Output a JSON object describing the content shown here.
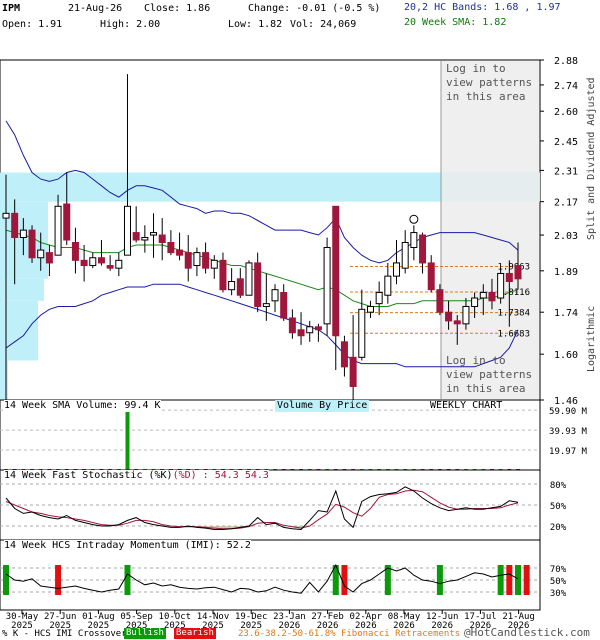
{
  "header": {
    "symbol": "IPM",
    "date": "21-Aug-26",
    "close": "Close: 1.86",
    "change": "Change: -0.01 (-0.5 %)",
    "open": "Open: 1.91",
    "high": "High: 2.00",
    "low": "Low: 1.82",
    "vol": "Vol: 24,069",
    "bands": "20,2 HC Bands: 1.68 , 1.97",
    "sma": "20 Week SMA: 1.82"
  },
  "side_label": "Split and Dividend Adjusted",
  "side_label2": "Logarithmic",
  "pattern_note_top": [
    "Log in to",
    "view patterns",
    "in this area"
  ],
  "pattern_note_bottom": [
    "Log in to",
    "view patterns",
    "in this area"
  ],
  "fib_levels": [
    "1.9063",
    "1.8116",
    "1.7384",
    "1.6683"
  ],
  "price_ticks": [
    "2.88",
    "2.74",
    "2.60",
    "2.45",
    "2.31",
    "2.17",
    "2.03",
    "1.89",
    "1.74",
    "1.60",
    "1.46"
  ],
  "vol_ticks": [
    "59.90 M",
    "39.93 M",
    "19.97 M"
  ],
  "stoch_ticks": [
    "80%",
    "50%",
    "20%"
  ],
  "imi_ticks": [
    "70%",
    "50%",
    "30%"
  ],
  "panel_labels": {
    "volume": "14 Week SMA Volume: 99.4 K",
    "vbp": "Volume By Price",
    "weekly": "WEEKLY CHART",
    "stoch_a": "14 Week Fast Stochastic (%K)",
    "stoch_b": "(%D) : 54.3",
    "stoch_c": "54.3",
    "imi": "14 Week HCS Intraday Momentum (IMI): 52.2"
  },
  "x_ticks": [
    "30-May 2025",
    "27-Jun 2025",
    "01-Aug 2025",
    "05-Sep 2025",
    "10-Oct 2025",
    "14-Nov 2025",
    "19-Dec 2025",
    "23-Jan 2026",
    "27-Feb 2026",
    "02-Apr 2026",
    "08-May 2026",
    "12-Jun 2026",
    "17-Jul 2026",
    "21-Aug 2026"
  ],
  "footer": {
    "crossover": "% K - HCS IMI Crossover:",
    "bullish": "Bullish",
    "bearish": "Bearish",
    "fib": "23.6-38.2-50-61.8% Fibonacci Retracements",
    "brand": "@HotCandlestick.com"
  },
  "colors": {
    "bull": "#ffffff",
    "bear": "#a0173c",
    "upper_band": "#1a1aa8",
    "sma": "#1a8a1a",
    "vbp": "#bff0fa",
    "fib": "#e07a10",
    "stoch_k": "#000000",
    "stoch_d": "#a0173c"
  },
  "chart_data": {
    "type": "candlestick",
    "scale": "log",
    "ylim": [
      1.46,
      2.88
    ],
    "candles": [
      {
        "o": 2.1,
        "h": 2.29,
        "l": 1.46,
        "c": 2.12
      },
      {
        "o": 2.12,
        "h": 2.18,
        "l": 1.84,
        "c": 2.02
      },
      {
        "o": 2.02,
        "h": 2.1,
        "l": 1.95,
        "c": 2.05
      },
      {
        "o": 2.05,
        "h": 2.07,
        "l": 1.92,
        "c": 1.94
      },
      {
        "o": 1.94,
        "h": 2.04,
        "l": 1.89,
        "c": 1.97
      },
      {
        "o": 1.96,
        "h": 1.99,
        "l": 1.87,
        "c": 1.92
      },
      {
        "o": 1.95,
        "h": 2.2,
        "l": 1.95,
        "c": 2.15
      },
      {
        "o": 2.16,
        "h": 2.3,
        "l": 1.99,
        "c": 2.01
      },
      {
        "o": 2.0,
        "h": 2.06,
        "l": 1.88,
        "c": 1.93
      },
      {
        "o": 1.93,
        "h": 1.99,
        "l": 1.85,
        "c": 1.91
      },
      {
        "o": 1.91,
        "h": 1.96,
        "l": 1.9,
        "c": 1.94
      },
      {
        "o": 1.94,
        "h": 2.01,
        "l": 1.91,
        "c": 1.92
      },
      {
        "o": 1.91,
        "h": 1.95,
        "l": 1.89,
        "c": 1.9
      },
      {
        "o": 1.9,
        "h": 1.96,
        "l": 1.87,
        "c": 1.93
      },
      {
        "o": 1.95,
        "h": 2.8,
        "l": 1.95,
        "c": 2.15
      },
      {
        "o": 2.04,
        "h": 2.15,
        "l": 2.0,
        "c": 2.01
      },
      {
        "o": 2.01,
        "h": 2.07,
        "l": 1.96,
        "c": 2.02
      },
      {
        "o": 2.03,
        "h": 2.12,
        "l": 1.94,
        "c": 2.04
      },
      {
        "o": 2.03,
        "h": 2.1,
        "l": 1.93,
        "c": 2.0
      },
      {
        "o": 2.0,
        "h": 2.05,
        "l": 1.95,
        "c": 1.96
      },
      {
        "o": 1.97,
        "h": 2.04,
        "l": 1.93,
        "c": 1.95
      },
      {
        "o": 1.96,
        "h": 2.03,
        "l": 1.85,
        "c": 1.9
      },
      {
        "o": 1.91,
        "h": 1.98,
        "l": 1.87,
        "c": 1.96
      },
      {
        "o": 1.96,
        "h": 2.0,
        "l": 1.88,
        "c": 1.9
      },
      {
        "o": 1.9,
        "h": 1.95,
        "l": 1.86,
        "c": 1.93
      },
      {
        "o": 1.93,
        "h": 1.96,
        "l": 1.81,
        "c": 1.82
      },
      {
        "o": 1.82,
        "h": 1.9,
        "l": 1.8,
        "c": 1.85
      },
      {
        "o": 1.86,
        "h": 1.9,
        "l": 1.79,
        "c": 1.8
      },
      {
        "o": 1.8,
        "h": 1.93,
        "l": 1.8,
        "c": 1.92
      },
      {
        "o": 1.92,
        "h": 1.96,
        "l": 1.74,
        "c": 1.76
      },
      {
        "o": 1.76,
        "h": 1.88,
        "l": 1.71,
        "c": 1.77
      },
      {
        "o": 1.78,
        "h": 1.84,
        "l": 1.74,
        "c": 1.82
      },
      {
        "o": 1.81,
        "h": 1.84,
        "l": 1.71,
        "c": 1.72
      },
      {
        "o": 1.72,
        "h": 1.75,
        "l": 1.65,
        "c": 1.67
      },
      {
        "o": 1.68,
        "h": 1.74,
        "l": 1.63,
        "c": 1.66
      },
      {
        "o": 1.67,
        "h": 1.71,
        "l": 1.64,
        "c": 1.69
      },
      {
        "o": 1.69,
        "h": 1.7,
        "l": 1.64,
        "c": 1.68
      },
      {
        "o": 1.7,
        "h": 2.02,
        "l": 1.66,
        "c": 1.98
      },
      {
        "o": 2.15,
        "h": 2.15,
        "l": 1.55,
        "c": 1.66
      },
      {
        "o": 1.64,
        "h": 1.66,
        "l": 1.53,
        "c": 1.56
      },
      {
        "o": 1.59,
        "h": 1.73,
        "l": 1.46,
        "c": 1.5
      },
      {
        "o": 1.59,
        "h": 1.82,
        "l": 1.58,
        "c": 1.75
      },
      {
        "o": 1.74,
        "h": 1.78,
        "l": 1.72,
        "c": 1.76
      },
      {
        "o": 1.77,
        "h": 1.85,
        "l": 1.73,
        "c": 1.81
      },
      {
        "o": 1.8,
        "h": 1.92,
        "l": 1.77,
        "c": 1.87
      },
      {
        "o": 1.87,
        "h": 2.01,
        "l": 1.84,
        "c": 1.92
      },
      {
        "o": 1.9,
        "h": 2.05,
        "l": 1.88,
        "c": 2.0
      },
      {
        "o": 1.98,
        "h": 2.07,
        "l": 1.93,
        "c": 2.04
      },
      {
        "o": 2.03,
        "h": 2.04,
        "l": 1.88,
        "c": 1.92
      },
      {
        "o": 1.92,
        "h": 1.95,
        "l": 1.81,
        "c": 1.82
      },
      {
        "o": 1.82,
        "h": 1.84,
        "l": 1.73,
        "c": 1.74
      },
      {
        "o": 1.74,
        "h": 1.78,
        "l": 1.68,
        "c": 1.71
      },
      {
        "o": 1.71,
        "h": 1.73,
        "l": 1.63,
        "c": 1.7
      },
      {
        "o": 1.7,
        "h": 1.79,
        "l": 1.68,
        "c": 1.76
      },
      {
        "o": 1.76,
        "h": 1.81,
        "l": 1.72,
        "c": 1.79
      },
      {
        "o": 1.79,
        "h": 1.84,
        "l": 1.73,
        "c": 1.81
      },
      {
        "o": 1.81,
        "h": 1.86,
        "l": 1.75,
        "c": 1.78
      },
      {
        "o": 1.79,
        "h": 1.9,
        "l": 1.77,
        "c": 1.88
      },
      {
        "o": 1.88,
        "h": 1.93,
        "l": 1.69,
        "c": 1.85
      },
      {
        "o": 1.91,
        "h": 2.0,
        "l": 1.82,
        "c": 1.86
      }
    ],
    "upper_band": [
      2.55,
      2.48,
      2.38,
      2.3,
      2.27,
      2.26,
      2.27,
      2.3,
      2.31,
      2.3,
      2.27,
      2.24,
      2.21,
      2.19,
      2.22,
      2.24,
      2.24,
      2.23,
      2.22,
      2.19,
      2.16,
      2.15,
      2.14,
      2.12,
      2.13,
      2.13,
      2.12,
      2.12,
      2.11,
      2.09,
      2.07,
      2.05,
      2.05,
      2.05,
      2.05,
      2.04,
      2.03,
      2.06,
      2.1,
      2.02,
      1.98,
      1.95,
      1.93,
      1.92,
      1.93,
      1.96,
      1.98,
      2.0,
      2.02,
      2.03,
      2.04,
      2.04,
      2.04,
      2.04,
      2.04,
      2.03,
      2.02,
      2.01,
      2.0,
      1.97
    ],
    "sma": [
      2.05,
      2.04,
      2.03,
      2.02,
      2.0,
      1.99,
      1.98,
      1.98,
      1.98,
      1.97,
      1.96,
      1.96,
      1.96,
      1.96,
      1.98,
      1.99,
      1.99,
      1.99,
      1.99,
      1.98,
      1.97,
      1.96,
      1.95,
      1.94,
      1.93,
      1.92,
      1.91,
      1.91,
      1.9,
      1.89,
      1.88,
      1.87,
      1.86,
      1.85,
      1.84,
      1.83,
      1.82,
      1.83,
      1.82,
      1.8,
      1.78,
      1.77,
      1.76,
      1.76,
      1.76,
      1.77,
      1.77,
      1.77,
      1.78,
      1.78,
      1.78,
      1.78,
      1.78,
      1.78,
      1.78,
      1.79,
      1.79,
      1.8,
      1.81,
      1.82
    ],
    "lower_band": [
      1.62,
      1.64,
      1.66,
      1.7,
      1.73,
      1.75,
      1.76,
      1.76,
      1.76,
      1.77,
      1.78,
      1.8,
      1.81,
      1.82,
      1.83,
      1.83,
      1.83,
      1.84,
      1.84,
      1.84,
      1.84,
      1.83,
      1.82,
      1.81,
      1.8,
      1.79,
      1.78,
      1.77,
      1.76,
      1.75,
      1.74,
      1.73,
      1.72,
      1.71,
      1.7,
      1.69,
      1.68,
      1.66,
      1.63,
      1.6,
      1.58,
      1.57,
      1.57,
      1.57,
      1.57,
      1.57,
      1.56,
      1.56,
      1.56,
      1.56,
      1.56,
      1.56,
      1.56,
      1.56,
      1.56,
      1.57,
      1.58,
      1.59,
      1.62,
      1.68
    ],
    "volume_M": [
      1,
      1,
      1,
      1,
      1,
      1,
      1,
      1,
      1,
      1,
      1,
      1,
      1,
      1,
      60,
      1,
      1,
      1,
      1,
      1,
      1,
      1,
      1,
      1,
      1,
      1,
      1,
      1,
      1,
      1,
      1,
      1,
      1,
      1,
      1,
      1,
      1,
      1,
      1,
      1,
      1,
      1,
      1,
      1,
      1,
      1,
      1,
      1,
      1,
      1,
      1,
      1,
      1,
      1,
      1,
      1,
      1,
      1,
      1,
      1
    ],
    "stoch_k": [
      60,
      45,
      38,
      40,
      35,
      32,
      30,
      35,
      28,
      25,
      22,
      20,
      20,
      22,
      28,
      32,
      25,
      22,
      20,
      18,
      18,
      20,
      18,
      17,
      15,
      15,
      16,
      18,
      20,
      32,
      22,
      24,
      18,
      16,
      15,
      28,
      42,
      40,
      70,
      30,
      18,
      55,
      62,
      65,
      66,
      68,
      76,
      70,
      60,
      52,
      46,
      42,
      44,
      46,
      44,
      44,
      46,
      48,
      56,
      54
    ],
    "stoch_d": [
      55,
      50,
      45,
      40,
      38,
      35,
      33,
      32,
      30,
      28,
      25,
      22,
      21,
      21,
      24,
      28,
      28,
      26,
      22,
      20,
      19,
      19,
      19,
      18,
      17,
      16,
      16,
      17,
      19,
      24,
      25,
      25,
      21,
      19,
      17,
      20,
      29,
      37,
      51,
      47,
      39,
      34,
      45,
      61,
      65,
      66,
      70,
      71,
      69,
      61,
      53,
      47,
      44,
      44,
      45,
      45,
      45,
      46,
      50,
      53
    ],
    "imi": [
      60,
      50,
      48,
      52,
      40,
      38,
      36,
      38,
      40,
      36,
      33,
      30,
      33,
      35,
      60,
      50,
      42,
      45,
      40,
      42,
      38,
      36,
      35,
      37,
      38,
      34,
      30,
      36,
      35,
      30,
      32,
      38,
      33,
      30,
      28,
      46,
      30,
      48,
      75,
      40,
      30,
      44,
      50,
      60,
      70,
      65,
      70,
      58,
      50,
      48,
      44,
      48,
      50,
      56,
      62,
      60,
      55,
      58,
      60,
      52
    ],
    "crossovers": [
      {
        "i": 0,
        "type": "bullish"
      },
      {
        "i": 6,
        "type": "bearish"
      },
      {
        "i": 14,
        "type": "bullish"
      },
      {
        "i": 38,
        "type": "bullish"
      },
      {
        "i": 39,
        "type": "bearish"
      },
      {
        "i": 44,
        "type": "bullish"
      },
      {
        "i": 50,
        "type": "bullish"
      },
      {
        "i": 57,
        "type": "bullish"
      },
      {
        "i": 58,
        "type": "bearish"
      },
      {
        "i": 59,
        "type": "bullish"
      },
      {
        "i": 60,
        "type": "bearish"
      }
    ],
    "x_tick_labels": [
      "30-May 2025",
      "27-Jun 2025",
      "01-Aug 2025",
      "05-Sep 2025",
      "10-Oct 2025",
      "14-Nov 2025",
      "19-Dec 2025",
      "23-Jan 2026",
      "27-Feb 2026",
      "02-Apr 2026",
      "08-May 2026",
      "12-Jun 2026",
      "17-Jul 2026",
      "21-Aug 2026"
    ]
  }
}
